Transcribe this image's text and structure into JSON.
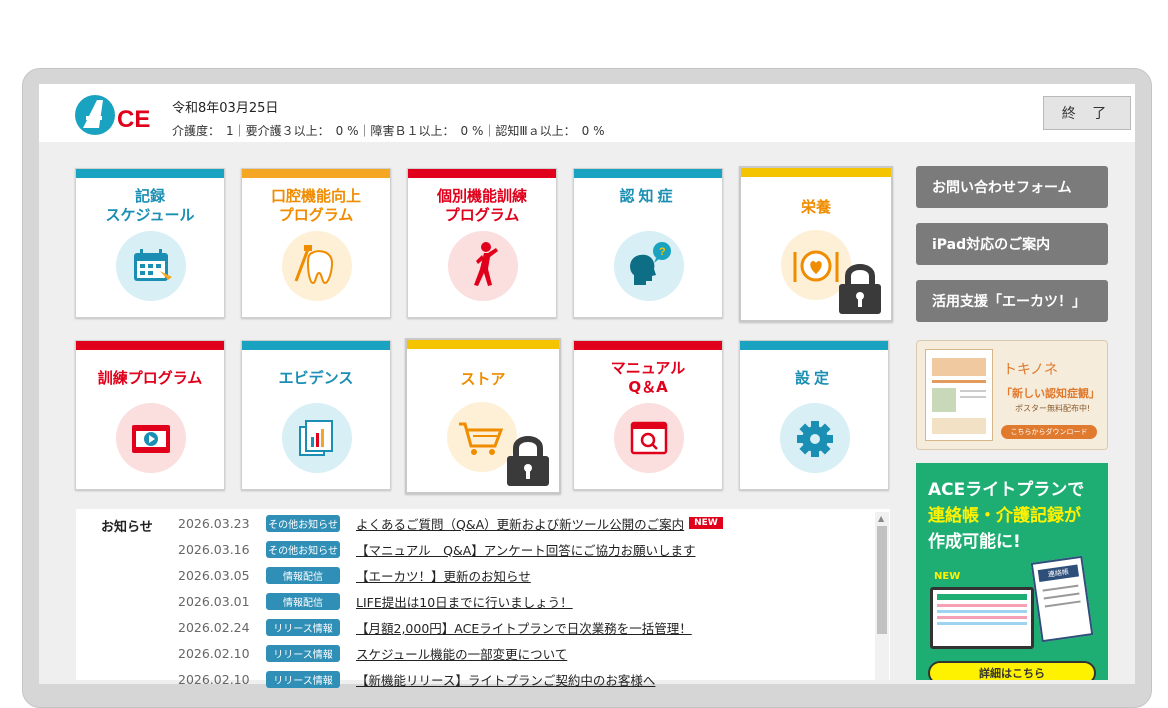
{
  "header": {
    "logo_text": "ACE",
    "date": "令和8年03月25日",
    "stats": "介護度：　1｜要介護３以上：　0 %｜障害Ｂ１以上：　0 %｜認知Ⅲａ以上：　0 %",
    "end_button": "終 了"
  },
  "tiles": [
    {
      "title": "記録\nスケジュール",
      "color": "#1aa3c0",
      "icon": "calendar-icon"
    },
    {
      "title": "口腔機能向上\nプログラム",
      "color": "#f5a623",
      "icon": "tooth-icon"
    },
    {
      "title": "個別機能訓練\nプログラム",
      "color": "#e0001b",
      "icon": "exercise-icon"
    },
    {
      "title": "認知症",
      "color": "#1aa3c0",
      "icon": "thinking-head-icon"
    },
    {
      "title": "栄養",
      "color": "#f5a623",
      "icon": "meal-icon",
      "locked": true
    },
    {
      "title": "訓練プログラム",
      "color": "#e0001b",
      "icon": "video-icon"
    },
    {
      "title": "エビデンス",
      "color": "#1aa3c0",
      "icon": "report-icon"
    },
    {
      "title": "ストア",
      "color": "#f5a623",
      "icon": "cart-icon",
      "locked": true
    },
    {
      "title": "マニュアル\nQ＆A",
      "color": "#e0001b",
      "icon": "manual-icon"
    },
    {
      "title": "設定",
      "color": "#1aa3c0",
      "icon": "gear-icon"
    }
  ],
  "side_buttons": [
    "お問い合わせフォーム",
    "iPad対応のご案内",
    "活用支援「エーカツ！」"
  ],
  "banner1": {
    "brand": "トキノネ",
    "headline": "「新しい認知症観」",
    "sub": "ポスター無料配布中!",
    "cta": "こちらからダウンロード"
  },
  "banner2": {
    "line1": "ACEライトプランで",
    "line2": "連絡帳・介護記録が",
    "line3": "作成可能に!",
    "new_tag": "NEW",
    "note_tag": "連絡帳",
    "cta": "詳細はこちら"
  },
  "news": {
    "label": "お知らせ",
    "items": [
      {
        "date": "2026.03.23",
        "category": "その他お知らせ",
        "title": "よくあるご質問（Q&A）更新および新ツール公開のご案内",
        "new": "NEW"
      },
      {
        "date": "2026.03.16",
        "category": "その他お知らせ",
        "title": "【マニュアル　Q&A】アンケート回答にご協力お願いします"
      },
      {
        "date": "2026.03.05",
        "category": "情報配信",
        "title": "【エーカツ！】更新のお知らせ"
      },
      {
        "date": "2026.03.01",
        "category": "情報配信",
        "title": "LIFE提出は10日までに行いましょう！"
      },
      {
        "date": "2026.02.24",
        "category": "リリース情報",
        "title": "【月額2,000円】ACEライトプランで日次業務を一括管理！"
      },
      {
        "date": "2026.02.10",
        "category": "リリース情報",
        "title": "スケジュール機能の一部変更について"
      },
      {
        "date": "2026.02.10",
        "category": "リリース情報",
        "title": "【新機能リリース】ライトプランご契約中のお客様へ"
      }
    ]
  }
}
